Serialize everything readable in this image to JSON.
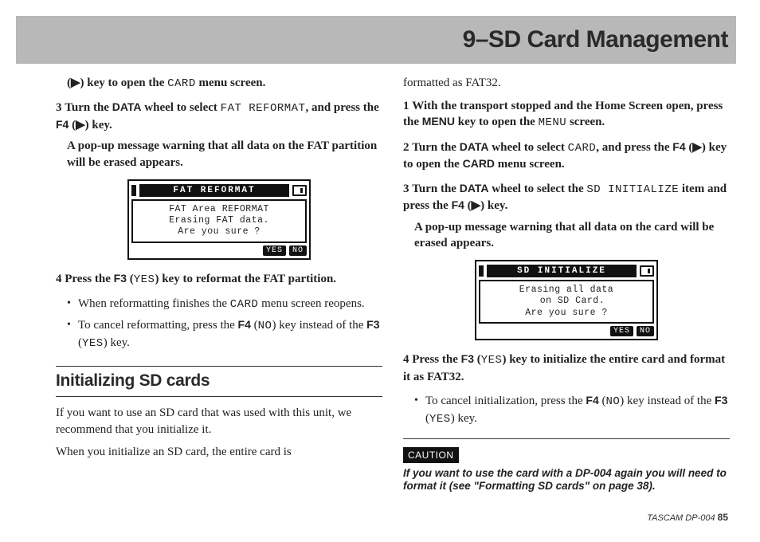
{
  "header": {
    "title": "9–SD Card Management"
  },
  "left": {
    "line_open": "(▶) key to open the ",
    "line_open_mono": "CARD",
    "line_open_tail": " menu screen.",
    "step3": {
      "num": "3",
      "a": "Turn the ",
      "data_key": "DATA",
      "b": " wheel to select ",
      "mono": "FAT REFORMAT",
      "c": ", and press the ",
      "f4": "F4",
      "d": " (▶) key.",
      "followup": "A pop-up message warning that all data on the FAT partition will be erased appears."
    },
    "lcd1": {
      "title": "FAT REFORMAT",
      "body": "FAT Area REFORMAT\nErasing FAT data.\nAre you sure ?",
      "yes": "YES",
      "no": "NO"
    },
    "step4": {
      "num": "4",
      "a": "Press the ",
      "f3": "F3",
      "b": " (",
      "yes_mono": "YES",
      "c": ") key to reformat the FAT partition."
    },
    "bullets": [
      {
        "a": "When reformatting finishes the ",
        "mono": "CARD",
        "b": " menu screen reopens."
      },
      {
        "a": "To cancel reformatting, press the ",
        "f4": "F4",
        "b": " (",
        "no_mono": "NO",
        "c": ") key instead of the ",
        "f3": "F3",
        "d": " (",
        "yes_mono": "YES",
        "e": ") key."
      }
    ],
    "section_title": "Initializing SD cards",
    "p1": "If you want to use an SD card that was used with this unit, we recommend that you initialize it.",
    "p2": "When you initialize an SD card, the entire card is"
  },
  "right": {
    "p0": "formatted as FAT32.",
    "step1": {
      "num": "1",
      "a": "With the transport stopped and the Home Screen open, press the ",
      "menu_key": "MENU",
      "b": " key to open the ",
      "menu_mono": "MENU",
      "c": " screen."
    },
    "step2": {
      "num": "2",
      "a": "Turn the ",
      "data_key": "DATA",
      "b": " wheel to select ",
      "card_mono": "CARD",
      "c": ", and press the ",
      "f4": "F4",
      "d": " (▶) key to open the ",
      "card_key": "CARD",
      "e": " menu screen."
    },
    "step3": {
      "num": "3",
      "a": "Turn the ",
      "data_key": "DATA",
      "b": " wheel to select the ",
      "mono": "SD INITIALIZE",
      "c": " item and press the ",
      "f4": "F4",
      "d": " (▶) key.",
      "followup": "A pop-up message warning that all data on the card will be erased appears."
    },
    "lcd2": {
      "title": "SD INITIALIZE",
      "body": "Erasing all data\n  on SD Card.\nAre you sure ?",
      "yes": "YES",
      "no": "NO"
    },
    "step4": {
      "num": "4",
      "a": "Press the ",
      "f3": "F3",
      "b": " (",
      "yes_mono": "YES",
      "c": ") key to initialize the entire card and format it as FAT32."
    },
    "bullets": [
      {
        "a": "To cancel initialization, press the ",
        "f4": "F4",
        "b": " (",
        "no_mono": "NO",
        "c": ") key instead of the ",
        "f3": "F3",
        "d": " (",
        "yes_mono": "YES",
        "e": ") key."
      }
    ],
    "caution_label": "CAUTION",
    "caution_text": "If you want to use the card with a DP-004 again you will need to format it (see \"Formatting SD cards\" on page 38)."
  },
  "footer": {
    "brand": "TASCAM  DP-004",
    "page": "85"
  }
}
